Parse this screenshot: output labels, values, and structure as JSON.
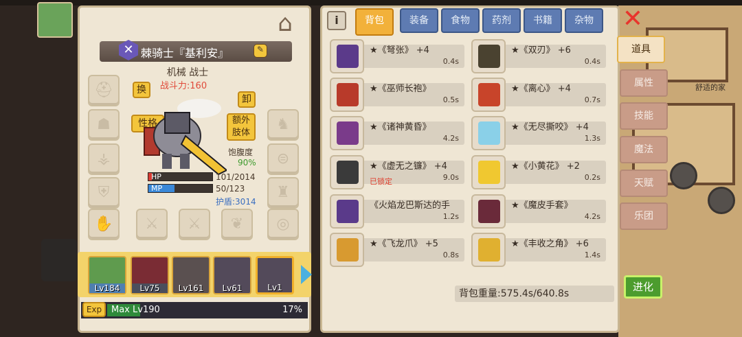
{
  "hero": {
    "name": "棘骑士『基利安』",
    "class": "机械 战士",
    "power_label": "战斗力:160",
    "buttons": {
      "swap": "换",
      "unequip": "卸",
      "personality": "性格",
      "extra_limb": "额外\n肢体"
    },
    "satiety_label": "饱腹度",
    "satiety_value": "90%",
    "hp_label": "HP",
    "hp_value": "101/2014",
    "hp_fill": 0.05,
    "mp_label": "MP",
    "mp_value": "50/123",
    "mp_fill": 0.41,
    "shield_label": "护盾:3014"
  },
  "party": [
    {
      "level": "Lv184",
      "color": "#5f9b4e"
    },
    {
      "level": "Lv75",
      "color": "#4f7fb0"
    },
    {
      "level": "Lv161",
      "color": "#7a2c34"
    },
    {
      "level": "Lv61",
      "color": "#4a4e5c"
    },
    {
      "level": "Lv1",
      "color": "#5a5050"
    }
  ],
  "exp": {
    "tag": "Exp",
    "label": "Max Lv190",
    "percent": "17%",
    "fill": 0.17
  },
  "tabs": [
    "背包",
    "装备",
    "食物",
    "药剂",
    "书籍",
    "杂物"
  ],
  "side_tabs": [
    "道具",
    "属性",
    "技能",
    "魔法",
    "天赋",
    "乐团"
  ],
  "items": [
    {
      "name": "★《弩张》 +4",
      "weight": "0.4s",
      "color": "#5b3a8a",
      "locked": ""
    },
    {
      "name": "★《双刃》 +6",
      "weight": "0.4s",
      "color": "#4a4230",
      "locked": ""
    },
    {
      "name": "★《巫师长袍》",
      "weight": "0.5s",
      "color": "#b83a2a",
      "locked": ""
    },
    {
      "name": "★《离心》 +4",
      "weight": "0.7s",
      "color": "#c8442a",
      "locked": ""
    },
    {
      "name": "★《诸神黄昏》",
      "weight": "4.2s",
      "color": "#7a3b8a",
      "locked": ""
    },
    {
      "name": "★《无尽撕咬》 +4",
      "weight": "1.3s",
      "color": "#8ad0e8",
      "locked": ""
    },
    {
      "name": "★《虚无之镰》 +4",
      "weight": "9.0s",
      "color": "#3a3a3a",
      "locked": "已锁定"
    },
    {
      "name": "★《小黄花》 +2",
      "weight": "0.2s",
      "color": "#f0c830",
      "locked": ""
    },
    {
      "name": "《火焰龙巴斯达的手",
      "weight": "1.2s",
      "color": "#5a3a8a",
      "locked": ""
    },
    {
      "name": "★《魔皮手套》",
      "weight": "4.2s",
      "color": "#6a2a3a",
      "locked": ""
    },
    {
      "name": "★《飞龙爪》 +5",
      "weight": "0.8s",
      "color": "#d89a30",
      "locked": ""
    },
    {
      "name": "★《丰收之角》 +6",
      "weight": "1.4s",
      "color": "#e0b030",
      "locked": ""
    }
  ],
  "weight_label": "背包重量:575.4s/640.8s",
  "evolve_label": "进化",
  "home_label": "舒适的家",
  "info_icon": "i"
}
